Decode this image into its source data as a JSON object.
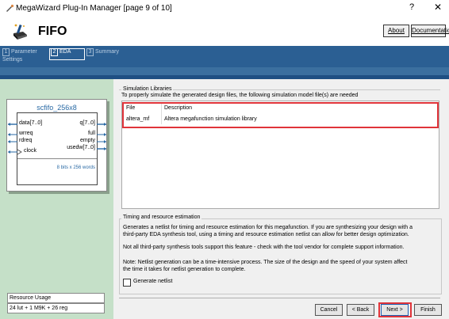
{
  "window": {
    "title": "MegaWizard Plug-In Manager [page 9 of 10]",
    "help_glyph": "?",
    "close_glyph": "✕"
  },
  "header": {
    "title": "FIFO",
    "about_label": "About",
    "documentation_label": "Documentation"
  },
  "steps": [
    {
      "num": "1",
      "label_line1": "Parameter",
      "label_line2": "Settings"
    },
    {
      "num": "2",
      "label_line1": "EDA",
      "label_line2": ""
    },
    {
      "num": "3",
      "label_line1": "Summary",
      "label_line2": ""
    }
  ],
  "symbol": {
    "name": "scfifo_256x8",
    "pins_left": [
      "data[7..0]",
      "wrreq",
      "rdreq",
      "clock"
    ],
    "pins_right": [
      "q[7..0]",
      "full",
      "empty",
      "usedw[7..0]"
    ],
    "note": "8 bits x 256 words"
  },
  "resource": {
    "label": "Resource Usage",
    "value": "24 lut + 1 M9K + 26 reg"
  },
  "simulation": {
    "group_title": "Simulation Libraries",
    "description": "To properly simulate the generated design files, the following simulation model file(s) are needed",
    "columns": [
      "File",
      "Description"
    ],
    "rows": [
      {
        "file": "altera_mf",
        "description": "Altera megafunction simulation library"
      }
    ]
  },
  "timing": {
    "group_title": "Timing and resource estimation",
    "para1_line1": "Generates a netlist for timing and resource estimation for this megafunction. If you are synthesizing your design with a",
    "para1_line2": "third-party EDA synthesis tool, using a timing and resource estimation netlist can allow for better design optimization.",
    "para2": "Not all third-party synthesis tools support this feature - check with the tool vendor for complete support information.",
    "para3_line1": "Note: Netlist generation can be a time-intensive process. The size of the design and the speed of your system affect",
    "para3_line2": "the time it takes for netlist generation to complete.",
    "checkbox_label": "Generate netlist",
    "checked": false
  },
  "buttons": {
    "cancel": "Cancel",
    "back": "< Back",
    "next": "Next >",
    "finish": "Finish"
  }
}
